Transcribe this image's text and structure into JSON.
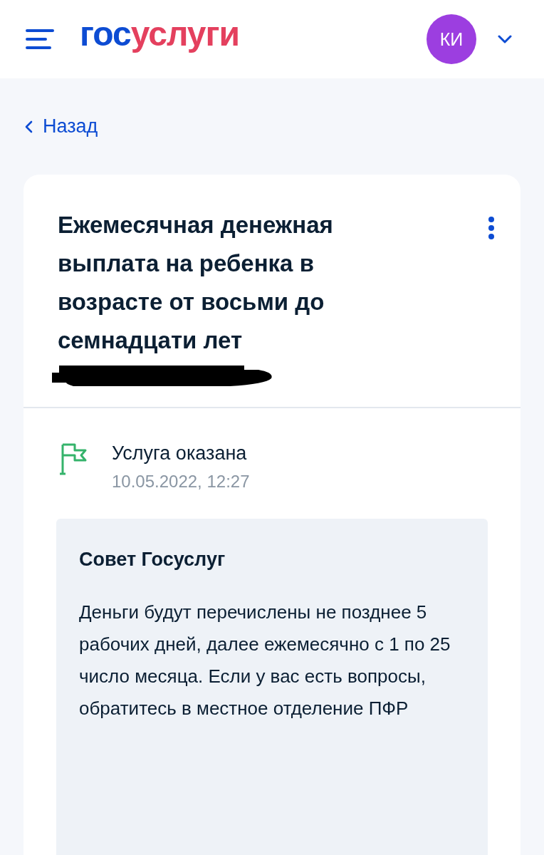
{
  "header": {
    "logo": [
      {
        "text": "гос",
        "color": "#0d4cd3"
      },
      {
        "text": "услуги",
        "color": "#e4405e"
      }
    ],
    "avatar": "КИ"
  },
  "back_link": "Назад",
  "card": {
    "title": "Ежемесячная денежная выплата на ребенка в возрасте от восьми до семнадцати лет",
    "status": {
      "label": "Услуга оказана",
      "time": "10.05.2022, 12:27"
    },
    "advice": {
      "title": "Совет Госуслуг",
      "text": "Деньги будут перечислены не позднее 5 рабочих дней, далее ежемесячно с 1 по 25 число месяца. Если у вас есть вопросы, обратитесь в местное отделение ПФР"
    }
  }
}
